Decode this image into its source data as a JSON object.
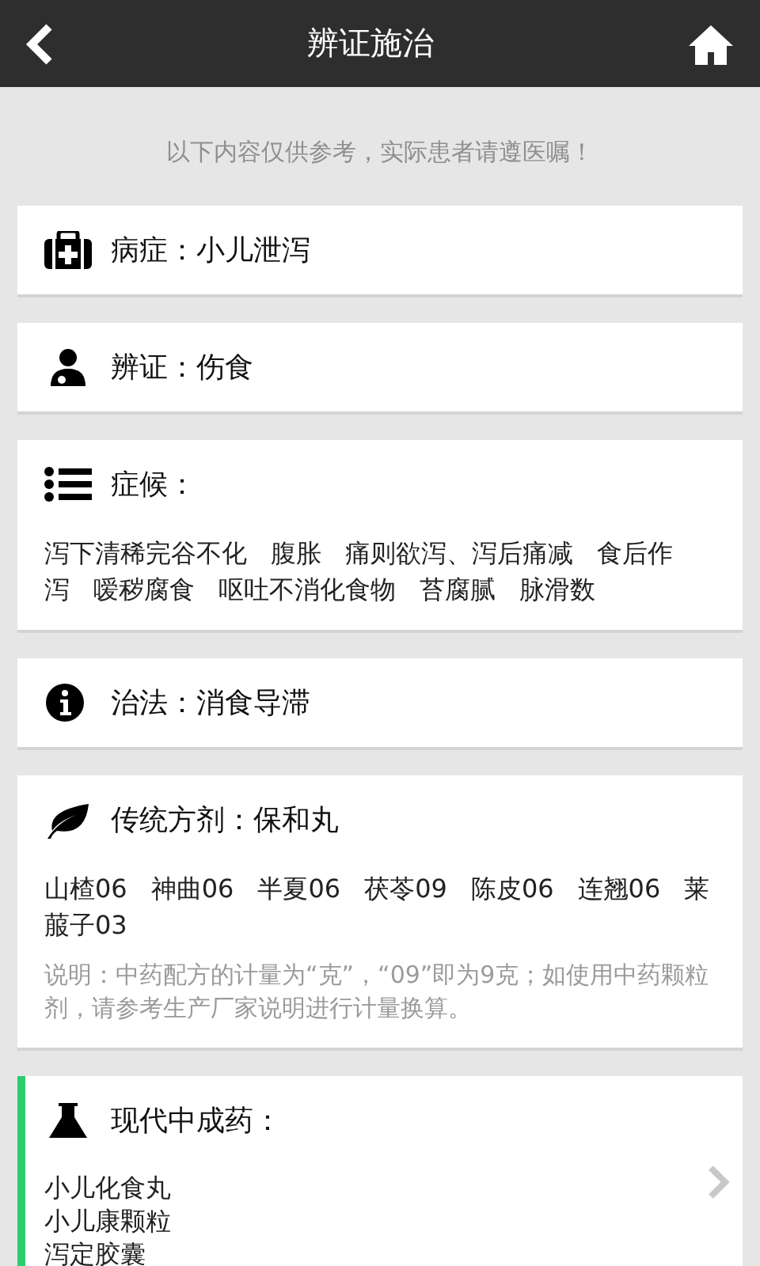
{
  "header": {
    "title": "辨证施治"
  },
  "notice": "以下内容仅供参考，实际患者请遵医嘱！",
  "sections": [
    {
      "kind": "single",
      "title": "病症：小儿泄泻",
      "accent": false
    },
    {
      "kind": "single",
      "title": "辨证：伤食",
      "accent": false
    },
    {
      "kind": "tags",
      "title": "症候：",
      "accent": false,
      "items": [
        "泻下清稀完谷不化",
        "腹胀",
        "痛则欲泻、泻后痛减",
        "食后作泻",
        "嗳秽腐食",
        "呕吐不消化食物",
        "苔腐腻",
        "脉滑数"
      ]
    },
    {
      "kind": "single",
      "title": "治法：消食导滞",
      "accent": false
    },
    {
      "kind": "tags",
      "title": "传统方剂：保和丸",
      "accent": false,
      "items": [
        "山楂06",
        "神曲06",
        "半夏06",
        "茯苓09",
        "陈皮06",
        "连翘06",
        "莱菔子03"
      ],
      "note": "说明：中药配方的计量为“克”，“09”即为9克；如使用中药颗粒剂，请参考生产厂家说明进行计量换算。"
    },
    {
      "kind": "lines",
      "title": "现代中成药：",
      "accent": true,
      "items": [
        "小儿化食丸",
        "小儿康颗粒",
        "泻定胶囊"
      ]
    }
  ]
}
